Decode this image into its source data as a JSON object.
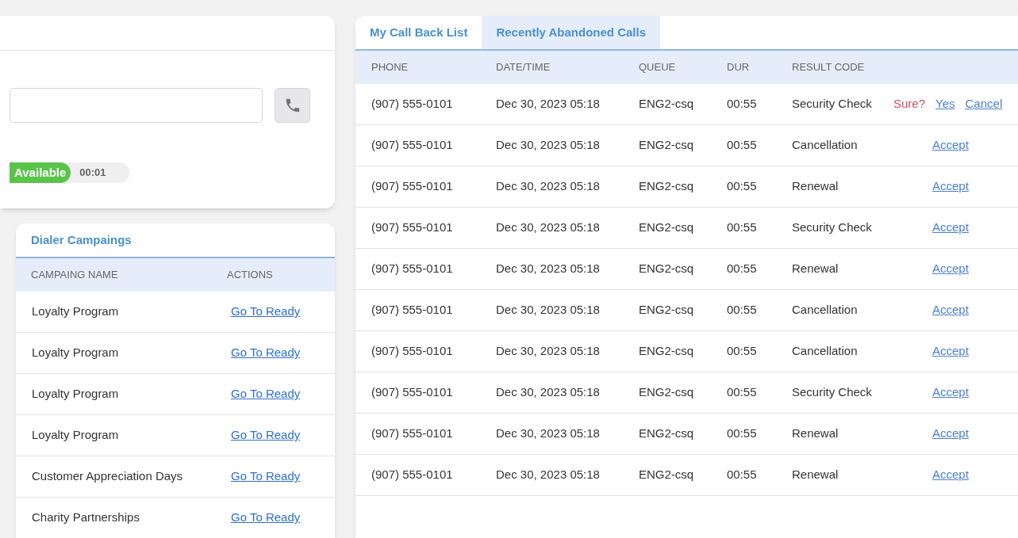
{
  "dialer": {
    "status": "Available",
    "timer": "00:01"
  },
  "campaigns": {
    "title": "Dialer Campaings",
    "columns": [
      "CAMPAING NAME",
      "ACTIONS"
    ],
    "rows": [
      {
        "name": "Loyalty Program",
        "action": "Go To Ready"
      },
      {
        "name": "Loyalty Program",
        "action": "Go To Ready"
      },
      {
        "name": "Loyalty Program",
        "action": "Go To Ready"
      },
      {
        "name": "Loyalty Program",
        "action": "Go To Ready"
      },
      {
        "name": "Customer Appreciation Days",
        "action": "Go To Ready"
      },
      {
        "name": "Charity Partnerships",
        "action": "Go To Ready"
      }
    ]
  },
  "tabs": [
    {
      "label": "My Call Back List",
      "selected": false
    },
    {
      "label": "Recently Abandoned Calls",
      "selected": true
    }
  ],
  "calls": {
    "columns": [
      "PHONE",
      "DATE/TIME",
      "QUEUE",
      "DUR",
      "RESULT CODE"
    ],
    "rows": [
      {
        "phone": "(907) 555-0101",
        "datetime": "Dec 30, 2023 05:18",
        "queue": "ENG2-csq",
        "dur": "00:55",
        "result": "Security Check",
        "kind": "confirm",
        "prompt": "Sure?",
        "yes": "Yes",
        "cancel": "Cancel"
      },
      {
        "phone": "(907) 555-0101",
        "datetime": "Dec 30, 2023 05:18",
        "queue": "ENG2-csq",
        "dur": "00:55",
        "result": "Cancellation",
        "kind": "accept",
        "action": "Accept"
      },
      {
        "phone": "(907) 555-0101",
        "datetime": "Dec 30, 2023 05:18",
        "queue": "ENG2-csq",
        "dur": "00:55",
        "result": "Renewal",
        "kind": "accept",
        "action": "Accept"
      },
      {
        "phone": "(907) 555-0101",
        "datetime": "Dec 30, 2023 05:18",
        "queue": "ENG2-csq",
        "dur": "00:55",
        "result": "Security Check",
        "kind": "accept",
        "action": "Accept"
      },
      {
        "phone": "(907) 555-0101",
        "datetime": "Dec 30, 2023 05:18",
        "queue": "ENG2-csq",
        "dur": "00:55",
        "result": "Renewal",
        "kind": "accept",
        "action": "Accept"
      },
      {
        "phone": "(907) 555-0101",
        "datetime": "Dec 30, 2023 05:18",
        "queue": "ENG2-csq",
        "dur": "00:55",
        "result": "Cancellation",
        "kind": "accept",
        "action": "Accept"
      },
      {
        "phone": "(907) 555-0101",
        "datetime": "Dec 30, 2023 05:18",
        "queue": "ENG2-csq",
        "dur": "00:55",
        "result": "Cancellation",
        "kind": "accept",
        "action": "Accept"
      },
      {
        "phone": "(907) 555-0101",
        "datetime": "Dec 30, 2023 05:18",
        "queue": "ENG2-csq",
        "dur": "00:55",
        "result": "Security Check",
        "kind": "accept",
        "action": "Accept"
      },
      {
        "phone": "(907) 555-0101",
        "datetime": "Dec 30, 2023 05:18",
        "queue": "ENG2-csq",
        "dur": "00:55",
        "result": "Renewal",
        "kind": "accept",
        "action": "Accept"
      },
      {
        "phone": "(907) 555-0101",
        "datetime": "Dec 30, 2023 05:18",
        "queue": "ENG2-csq",
        "dur": "00:55",
        "result": "Renewal",
        "kind": "accept",
        "action": "Accept"
      }
    ]
  }
}
